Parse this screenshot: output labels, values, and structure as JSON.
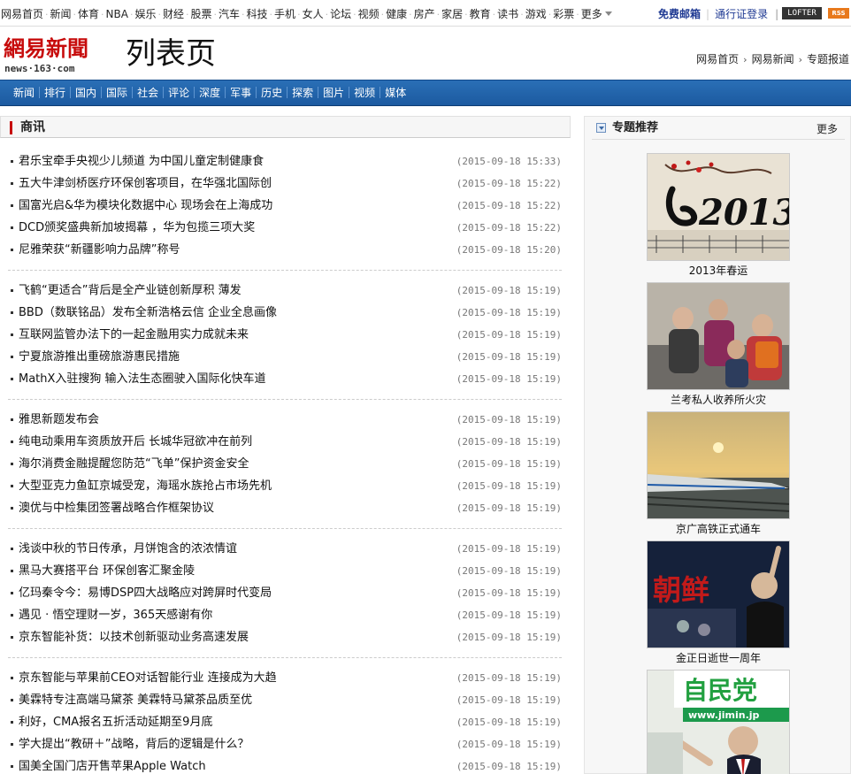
{
  "topbar": {
    "nav": [
      "网易首页",
      "新闻",
      "体育",
      "NBA",
      "娱乐",
      "财经",
      "股票",
      "汽车",
      "科技",
      "手机",
      "女人",
      "论坛",
      "视频",
      "健康",
      "房产",
      "家居",
      "教育",
      "读书",
      "游戏",
      "彩票"
    ],
    "more": "更多",
    "mail": "免费邮箱",
    "passport": "通行证登录",
    "lofter": "LOFTER",
    "rss": "RSS"
  },
  "header": {
    "logo_cn": "網易新聞",
    "logo_en": "news·163·com",
    "page_title": "列表页",
    "breadcrumb": [
      "网易首页",
      "网易新闻",
      "专题报道"
    ]
  },
  "channel_nav": [
    "新闻",
    "排行",
    "国内",
    "国际",
    "社会",
    "评论",
    "深度",
    "军事",
    "历史",
    "探索",
    "图片",
    "视频",
    "媒体"
  ],
  "section": {
    "title": "商讯",
    "groups": [
      [
        {
          "title": "君乐宝牵手央视少儿频道 为中国儿童定制健康食",
          "date": "(2015-09-18 15:33)"
        },
        {
          "title": "五大牛津剑桥医疗环保创客项目，在华强北国际创",
          "date": "(2015-09-18 15:22)"
        },
        {
          "title": "国富光启&华为模块化数据中心 现场会在上海成功",
          "date": "(2015-09-18 15:22)"
        },
        {
          "title": "DCD颁奖盛典新加坡揭幕 ，华为包揽三项大奖",
          "date": "(2015-09-18 15:22)"
        },
        {
          "title": "尼雅荣获“新疆影响力品牌”称号",
          "date": "(2015-09-18 15:20)"
        }
      ],
      [
        {
          "title": "飞鹤“更适合”背后是全产业链创新厚积 薄发",
          "date": "(2015-09-18 15:19)"
        },
        {
          "title": "BBD（数联铭品）发布全新浩格云信 企业全息画像",
          "date": "(2015-09-18 15:19)"
        },
        {
          "title": "互联网监管办法下的一起金融用实力成就未来",
          "date": "(2015-09-18 15:19)"
        },
        {
          "title": "宁夏旅游推出重磅旅游惠民措施",
          "date": "(2015-09-18 15:19)"
        },
        {
          "title": "MathX入驻搜狗 输入法生态圈驶入国际化快车道",
          "date": "(2015-09-18 15:19)"
        }
      ],
      [
        {
          "title": "雅思新题发布会",
          "date": "(2015-09-18 15:19)"
        },
        {
          "title": "纯电动乘用车资质放开后 长城华冠欲冲在前列",
          "date": "(2015-09-18 15:19)"
        },
        {
          "title": "海尔消费金融提醒您防范“飞单”保护资金安全",
          "date": "(2015-09-18 15:19)"
        },
        {
          "title": "大型亚克力鱼缸京城受宠，海瑶水族抢占市场先机",
          "date": "(2015-09-18 15:19)"
        },
        {
          "title": "澳优与中检集团签署战略合作框架协议",
          "date": "(2015-09-18 15:19)"
        }
      ],
      [
        {
          "title": "浅谈中秋的节日传承，月饼饱含的浓浓情谊",
          "date": "(2015-09-18 15:19)"
        },
        {
          "title": "黑马大赛搭平台 环保创客汇聚金陵",
          "date": "(2015-09-18 15:19)"
        },
        {
          "title": "亿玛秦令今：易博DSP四大战略应对跨屏时代变局",
          "date": "(2015-09-18 15:19)"
        },
        {
          "title": "遇见 · 悟空理财一岁，365天感谢有你",
          "date": "(2015-09-18 15:19)"
        },
        {
          "title": "京东智能补货：以技术创新驱动业务高速发展",
          "date": "(2015-09-18 15:19)"
        }
      ],
      [
        {
          "title": "京东智能与苹果前CEO对话智能行业 连接成为大趋",
          "date": "(2015-09-18 15:19)"
        },
        {
          "title": "美霖特专注高端马黛茶 美霖特马黛茶品质至优",
          "date": "(2015-09-18 15:19)"
        },
        {
          "title": "利好，CMA报名五折活动延期至9月底",
          "date": "(2015-09-18 15:19)"
        },
        {
          "title": "学大提出“教研＋”战略，背后的逻辑是什么？",
          "date": "(2015-09-18 15:19)"
        },
        {
          "title": "国美全国门店开售苹果Apple Watch",
          "date": "(2015-09-18 15:19)"
        }
      ]
    ]
  },
  "sidebar": {
    "title": "专题推荐",
    "more": "更多",
    "topics": [
      {
        "caption": "2013年春运",
        "image_text": "2013",
        "icon": "chinese-new-year-calligraphy-image"
      },
      {
        "caption": "兰考私人收养所火灾",
        "icon": "children-photo-image"
      },
      {
        "caption": "京广高铁正式通车",
        "icon": "high-speed-train-image"
      },
      {
        "caption": "金正日逝世一周年",
        "image_text": "朝鲜",
        "icon": "korea-leader-image"
      },
      {
        "caption": "",
        "image_text": "自民党",
        "image_subtext": "www.jimin.jp",
        "icon": "japan-politician-image"
      }
    ]
  },
  "colors": {
    "brand_red": "#c70c0c",
    "nav_blue": "#1c5aa0",
    "link_blue": "#1f3a93"
  }
}
